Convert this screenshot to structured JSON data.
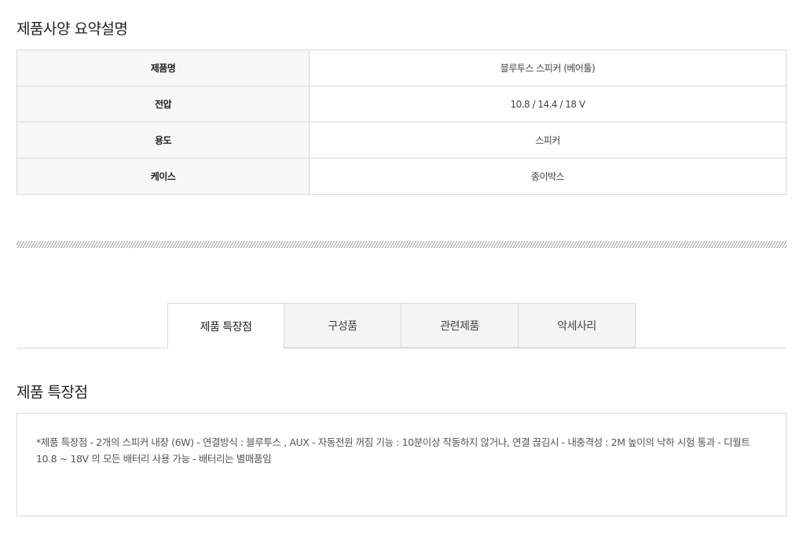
{
  "spec_section": {
    "title": "제품사양 요약설명",
    "rows": [
      {
        "label": "제품명",
        "value": "블루투스 스피커 (베어툴)"
      },
      {
        "label": "전압",
        "value": "10.8 / 14.4 / 18 V"
      },
      {
        "label": "용도",
        "value": "스피커"
      },
      {
        "label": "케이스",
        "value": "종이박스"
      }
    ]
  },
  "tabs": [
    {
      "label": "제품 특장점",
      "active": true
    },
    {
      "label": "구성품",
      "active": false
    },
    {
      "label": "관련제품",
      "active": false
    },
    {
      "label": "악세사리",
      "active": false
    }
  ],
  "feature_section": {
    "title": "제품 특장점",
    "description": "*제품 특장점 - 2개의 스피커 내장 (6W) - 연결방식 : 블루투스 , AUX - 자동전원 꺼짐 기능 : 10분이상 작동하지 않거나, 연결 끊김시 - 내충격성 : 2M 높이의 낙하 시험 통과 - 디월트 10.8 ~ 18V 의 모든 배터리 사용 가능 - 배터리는 별매품임"
  }
}
